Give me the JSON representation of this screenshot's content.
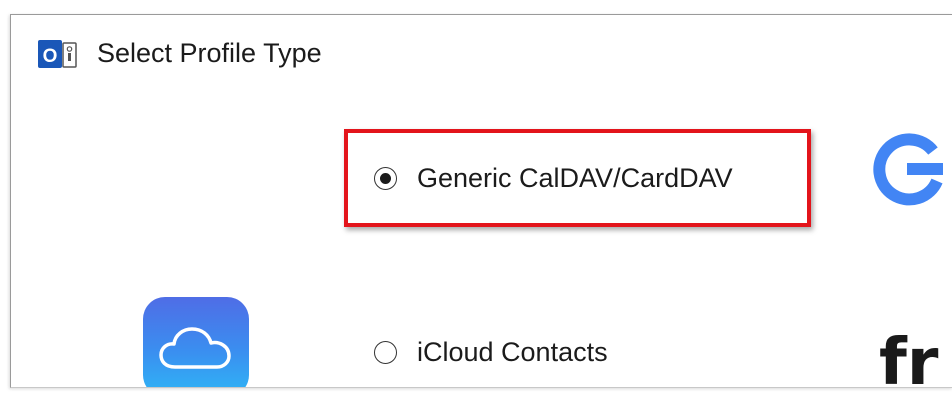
{
  "dialog": {
    "title": "Select Profile Type",
    "app_icon": "outlook-sync-icon"
  },
  "options": [
    {
      "label": "Generic CalDAV/CardDAV",
      "selected": true,
      "highlighted": true,
      "logo": "google-logo"
    },
    {
      "label": "iCloud Contacts",
      "selected": false,
      "logo": "icloud-icon"
    }
  ],
  "partial_logos": {
    "google_letter": "G",
    "fr_text": "fr"
  },
  "colors": {
    "highlight_border": "#e3141b",
    "google_blue": "#4285f4",
    "icloud_gradient_top": "#4f6de6",
    "icloud_gradient_bottom": "#2fb6f6"
  }
}
